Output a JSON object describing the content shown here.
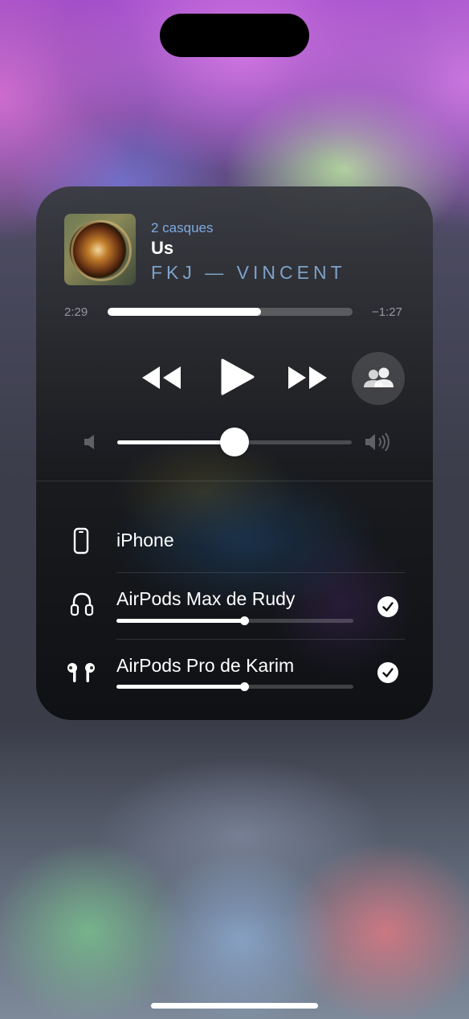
{
  "now_playing": {
    "subtitle": "2 casques",
    "title": "Us",
    "artist": "FKJ — VINCENT"
  },
  "progress": {
    "elapsed": "2:29",
    "remaining": "−1:27",
    "fraction": 0.625
  },
  "controls": {
    "rewind_icon": "backward-icon",
    "play_icon": "play-icon",
    "forward_icon": "forward-icon",
    "share_audio_icon": "share-audio-people-icon"
  },
  "volume": {
    "level": 0.5
  },
  "devices": [
    {
      "name": "iPhone",
      "icon": "iphone-icon",
      "selected": false
    },
    {
      "name": "AirPods Max de Rudy",
      "icon": "airpods-max-icon",
      "selected": true,
      "volume": 0.54
    },
    {
      "name": "AirPods Pro de Karim",
      "icon": "airpods-pro-icon",
      "selected": true,
      "volume": 0.54
    }
  ],
  "colors": {
    "accent_blue": "#7eaae0",
    "artist_blue": "#7fa2c8"
  }
}
